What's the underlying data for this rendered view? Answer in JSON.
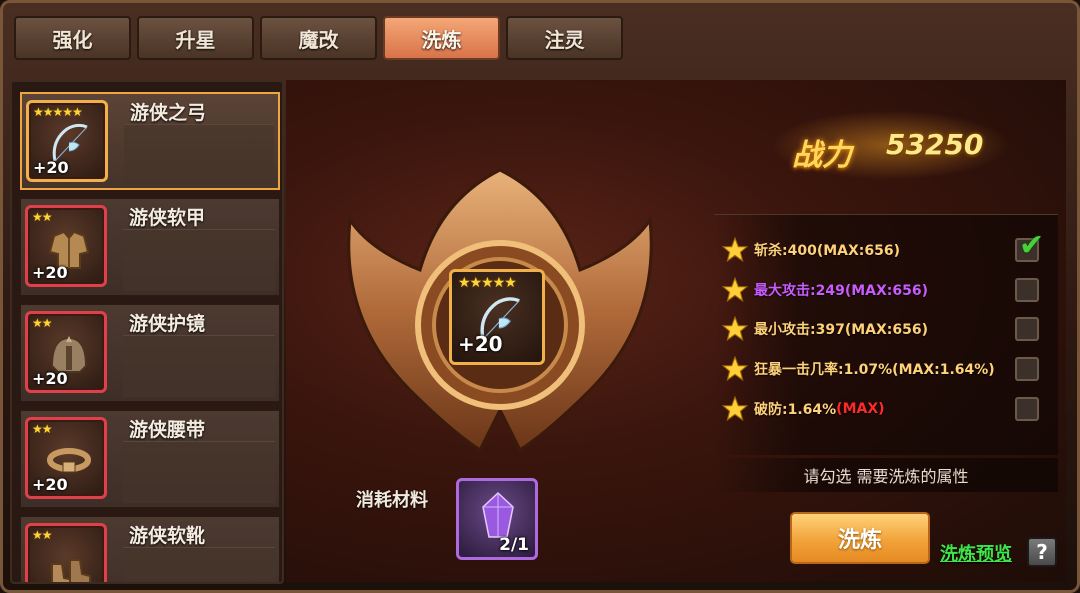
{
  "tabs": [
    {
      "label": "强化"
    },
    {
      "label": "升星"
    },
    {
      "label": "魔改"
    },
    {
      "label": "洗炼"
    },
    {
      "label": "注灵"
    }
  ],
  "active_tab": "洗炼",
  "equipment": [
    {
      "name": "游侠之弓",
      "stars": "★★★★★",
      "level": "+20",
      "icon": "bow-icon",
      "selected": true
    },
    {
      "name": "游侠软甲",
      "stars": "★★",
      "level": "+20",
      "icon": "armor-icon"
    },
    {
      "name": "游侠护镜",
      "stars": "★★",
      "level": "+20",
      "icon": "helmet-icon"
    },
    {
      "name": "游侠腰带",
      "stars": "★★",
      "level": "+20",
      "icon": "belt-icon"
    },
    {
      "name": "游侠软靴",
      "stars": "★★",
      "level": "",
      "icon": "boots-icon"
    }
  ],
  "selected_item": {
    "stars": "★★★★★",
    "level": "+20",
    "icon": "bow-icon"
  },
  "power": {
    "label": "战力",
    "value": "53250"
  },
  "attributes": [
    {
      "text": "斩杀:400(MAX:656)",
      "max_flag": "",
      "color": "#ffd27a",
      "checked": true
    },
    {
      "text": "最大攻击:249(MAX:656)",
      "max_flag": "",
      "color": "#c85cff",
      "checked": false
    },
    {
      "text": "最小攻击:397(MAX:656)",
      "max_flag": "",
      "color": "#ffd27a",
      "checked": false
    },
    {
      "text": "狂暴一击几率:1.07%(MAX:1.64%)",
      "max_flag": "",
      "color": "#ffd27a",
      "checked": false
    },
    {
      "text": "破防:1.64%",
      "max_flag": "(MAX)",
      "color": "#ffd27a",
      "checked": false
    }
  ],
  "hint": "请勾选 需要洗炼的属性",
  "material": {
    "label": "消耗材料",
    "count": "2/1",
    "icon": "crystal-icon"
  },
  "refine_button": "洗炼",
  "preview_link": "洗炼预览",
  "help_label": "?"
}
